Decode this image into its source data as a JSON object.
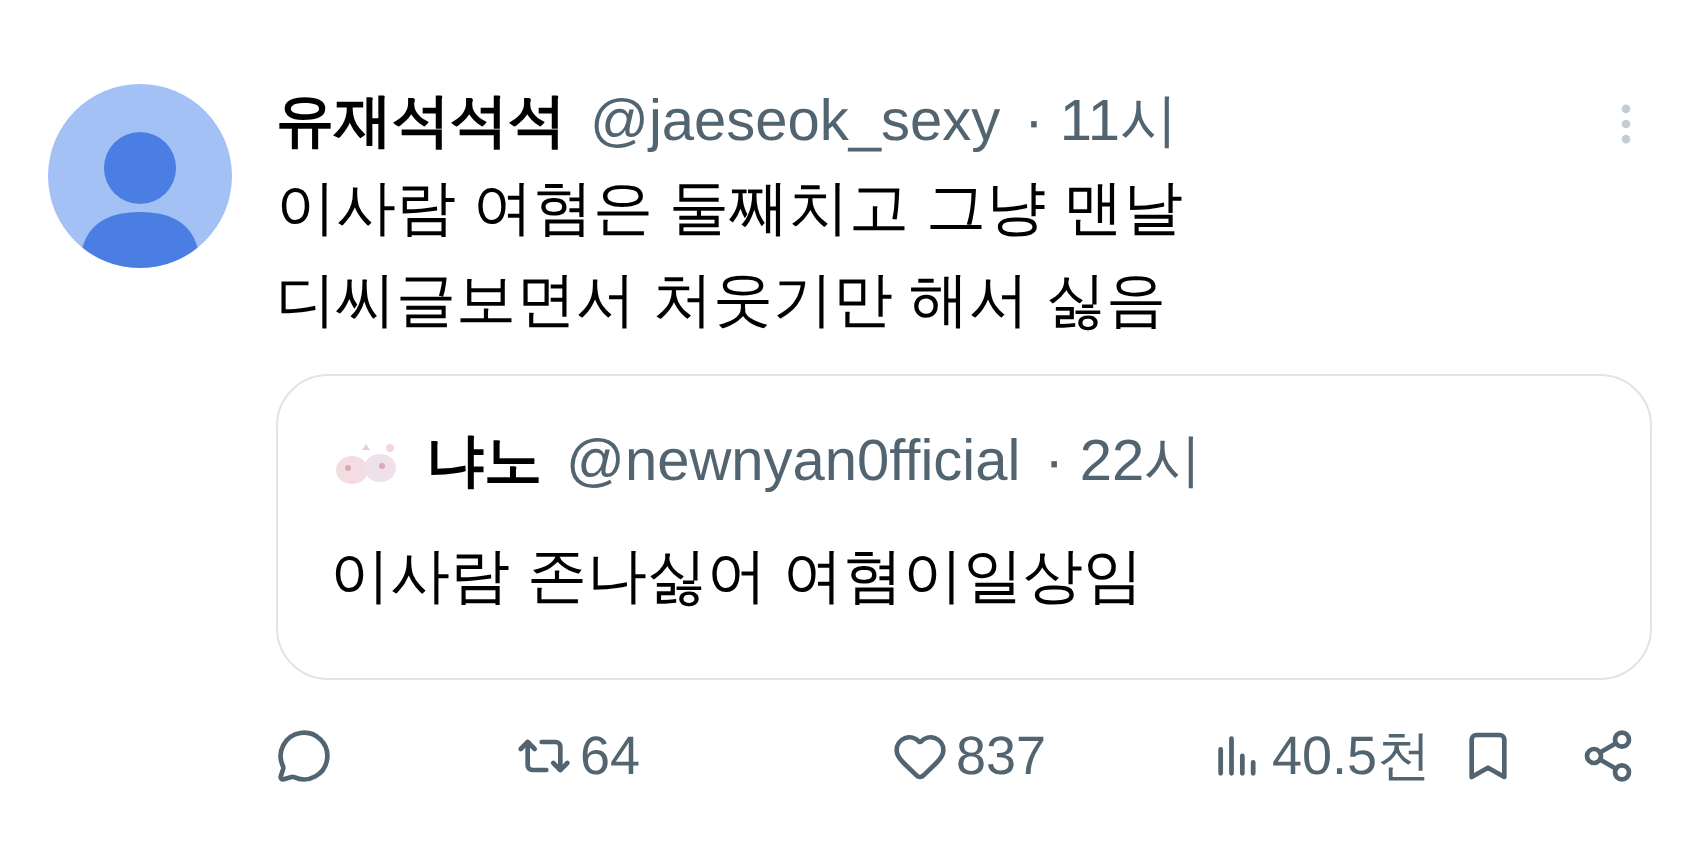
{
  "tweet": {
    "display_name": "유재석석석",
    "handle": "@jaeseok_sexy",
    "time": "· 11시",
    "lines": [
      "이사람 여혐은 둘째치고 그냥 맨날",
      "디씨글보면서 처웃기만 해서 싫음"
    ]
  },
  "quote": {
    "display_name": "냐노",
    "handle": "@newnyan0fficial",
    "time": "· 22시",
    "text": "이사람 존나싫어 여혐이일상임"
  },
  "actions": [
    {
      "kind": "reply"
    },
    {
      "kind": "retweet",
      "count": "64"
    },
    {
      "kind": "like",
      "count": "837"
    },
    {
      "kind": "views",
      "count": "40.5천"
    },
    {
      "kind": "bookmark"
    },
    {
      "kind": "share"
    }
  ]
}
